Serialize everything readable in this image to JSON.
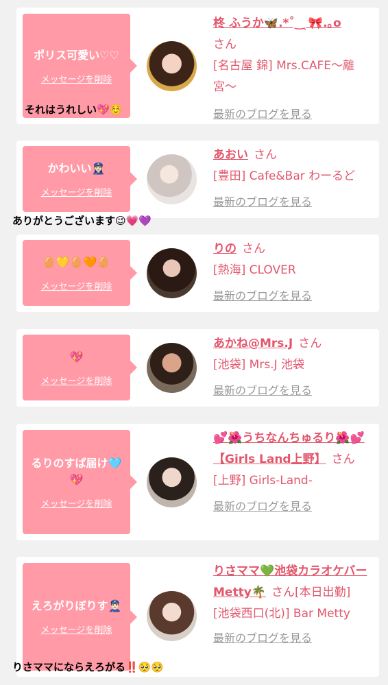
{
  "delete_label": "メッセージを削除",
  "blog_label": "最新のブログを見る",
  "san_label": "さん",
  "cards": [
    {
      "message": "ポリス可愛い♡♡",
      "name": "柊 ふうか🦋.*˚‿ ̖🎀.｡o",
      "shop": "[名古屋 錦] Mrs.CAFE〜離宮〜",
      "reply": "それはうれしい💖☺️"
    },
    {
      "message": "かわいい👮🏻‍♀️",
      "name": "あおい",
      "shop": "[豊田] Cafe&Bar わーるど",
      "reply": "ありがとうございます😉💗💜"
    },
    {
      "message": "🥚💛🥚🧡🥚",
      "name": "りの",
      "shop": "[熱海] CLOVER",
      "reply": ""
    },
    {
      "message": "💖",
      "name": "あかね@Mrs.J",
      "shop": "[池袋] Mrs.J 池袋",
      "reply": ""
    },
    {
      "message": "るりのすぱ届け🩵💖",
      "name": "💕🌺うちなんちゅるり🌺💕【Girls Land上野】",
      "shop": "[上野] Girls-Land-",
      "reply": ""
    },
    {
      "message": "えろがりぼりす👮🏻‍♂️",
      "name": "りさママ💚池袋カラオケバーMetty🌴",
      "shop_prefix": "[本日出勤]",
      "shop": "[池袋西口(北)] Bar Metty",
      "reply": "りさママにならえろがる‼️🥺🥺"
    }
  ]
}
